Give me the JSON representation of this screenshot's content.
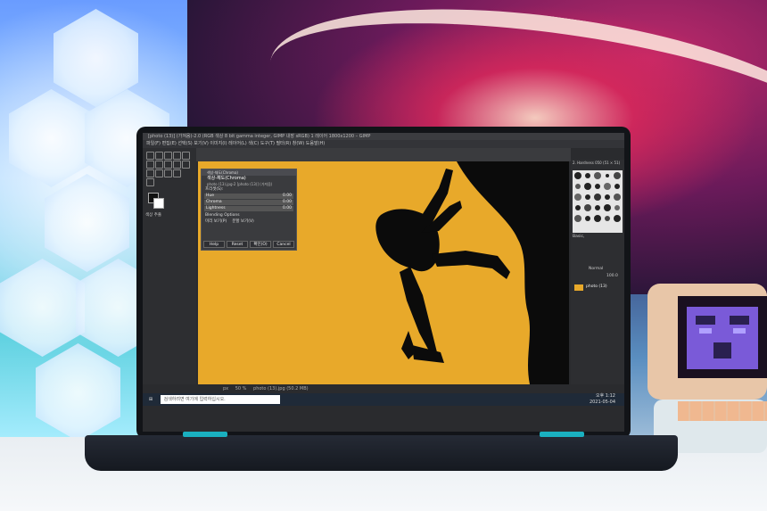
{
  "window": {
    "title": "[photo (13)] (가져옴)-2.0 (RGB 색상 8 bit gamma integer, GIMP 내장 sRGB) 1 레이어 1800x1200 – GIMP"
  },
  "menu": {
    "items": "파일(F)  편집(E)  선택(S)  보기(V)  이미지(I)  레이어(L)  색(C)  도구(T)  필터(R)  창(W)  도움말(H)"
  },
  "toolbox": {
    "options_label": "색상 추출"
  },
  "dialog": {
    "window_title": "색상-채도(Chroma)",
    "heading": "색상-채도(Chroma)",
    "subheading": "photo (13).jpg-2 [photo (13)] (가져옴)",
    "presets_label": "프리셋(S):",
    "sliders": [
      {
        "label": "Hue",
        "value": "0.00"
      },
      {
        "label": "Chroma",
        "value": "0.00"
      },
      {
        "label": "Lightness",
        "value": "0.00"
      }
    ],
    "blending_label": "Blending Options",
    "preview_label": "미리 보기(P)",
    "split_label": "분할 보기(V)",
    "buttons": [
      "Help",
      "Reset",
      "확인(O)",
      "Cancel"
    ]
  },
  "right_dock": {
    "brush_name": "2. Hardness 050 (51 × 51)",
    "filter_label": "Basic,",
    "mode_label": "Normal",
    "opacity_label": "100.0",
    "layer_name": "photo (13)"
  },
  "statusbar": {
    "unit": "px",
    "zoom": "50 %",
    "file": "photo (13).jpg (50.2 MB)"
  },
  "taskbar": {
    "search_placeholder": "검색하려면 여기에 입력하십시오.",
    "time": "오후 1:12",
    "date": "2021-05-04"
  },
  "colors": {
    "canvas": "#e8a92a",
    "gimp_bg": "#2d2e31",
    "accent": "#1ab0c0"
  }
}
